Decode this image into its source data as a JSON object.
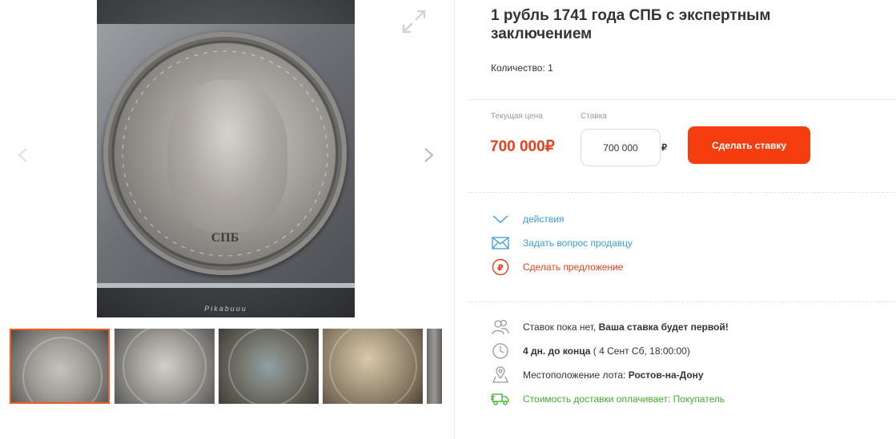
{
  "lot": {
    "title": "1 рубль 1741 года СПБ с экспертным заключением",
    "quantity": "Количество: 1"
  },
  "gallery": {
    "main_photo_icon": "coin-photo",
    "coin_mark": "СПБ",
    "photo_credit": "Pikabuuu",
    "thumbnails": 5,
    "active_thumbnail": 1
  },
  "bidding": {
    "current_price_label": "Текущая цена",
    "current_price": "700 000₽",
    "bid_label": "Ставка",
    "bid_value": "700 000",
    "bid_currency": "₽",
    "bid_button": "Сделать ставку"
  },
  "actions": [
    {
      "label": "действия",
      "icon": "chevron-down-icon"
    },
    {
      "label": "Задать вопрос продавцу",
      "icon": "envelope-icon"
    },
    {
      "label": "Сделать предложение",
      "icon": "ruble-circle-icon"
    }
  ],
  "info": {
    "bids_prefix": "Ставок пока нет,",
    "bids_bold": "Ваша ставка будет первой!",
    "time_bold": "4 дн. до конца",
    "time_rest": "( 4 Сент Сб, 18:00:00)",
    "location_prefix": "Местоположение лота:",
    "location_bold": "Ростов-на-Дону",
    "delivery": "Стоимость доставки оплачивает: Покупатель"
  },
  "colors": {
    "accent": "#f53d0f",
    "price": "#e8401c",
    "link": "#3c9ed5",
    "delivery": "#3fae29"
  }
}
